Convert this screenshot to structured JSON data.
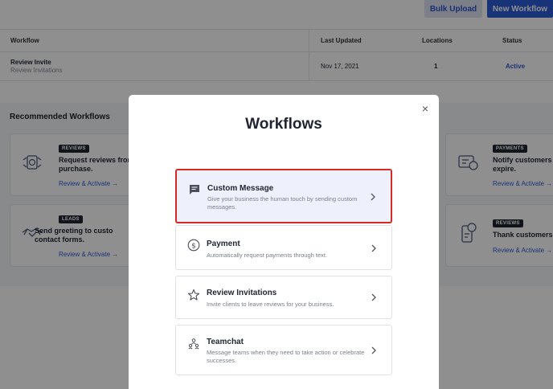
{
  "header": {
    "bulk_upload_label": "Bulk Upload",
    "new_workflow_label": "New Workflow"
  },
  "table": {
    "columns": [
      "Workflow",
      "Last Updated",
      "Locations",
      "Status"
    ],
    "rows": [
      {
        "name": "Review Invite",
        "subtitle": "Review Invitations",
        "last_updated": "Nov 17, 2021",
        "locations": "1",
        "status": "Active"
      }
    ]
  },
  "recommended": {
    "title": "Recommended Workflows",
    "cards": [
      {
        "tag": "REVIEWS",
        "line1": "Request reviews from",
        "line2": "purchase.",
        "link": "Review & Activate →"
      },
      {
        "tag": "LEADS",
        "line1": "Send greeting to custo",
        "line2": "contact forms.",
        "link": "Review & Activate →"
      },
      {
        "tag": "PAYMENTS",
        "line1": "Notify customers b",
        "line2": "expire.",
        "link": "Review & Activate →"
      },
      {
        "tag": "REVIEWS",
        "line1": "Thank customers fo",
        "line2": "",
        "link": "Review & Activate →"
      }
    ]
  },
  "modal": {
    "title": "Workflows",
    "close_icon": "×",
    "items": [
      {
        "label": "Custom Message",
        "description": "Give your business the human touch by sending custom messages.",
        "icon": "message-icon",
        "selected": true
      },
      {
        "label": "Payment",
        "description": "Automatically request payments through text.",
        "icon": "dollar-icon",
        "selected": false
      },
      {
        "label": "Review Invitations",
        "description": "Invite clients to leave reviews for your business.",
        "icon": "star-icon",
        "selected": false
      },
      {
        "label": "Teamchat",
        "description": "Message teams when they need to take action or celebrate successes.",
        "icon": "team-icon",
        "selected": false
      }
    ]
  },
  "colors": {
    "accent": "#2d5cd6",
    "highlight_border": "#d62b22",
    "selected_bg": "#eef1fb"
  }
}
